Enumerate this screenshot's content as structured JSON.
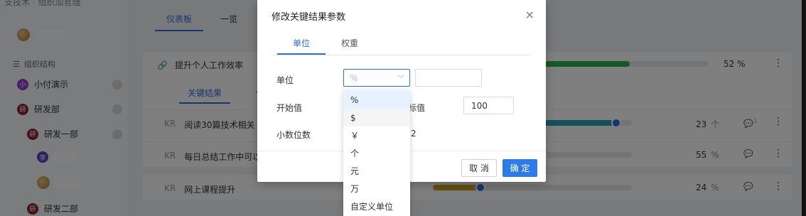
{
  "sidebar": {
    "top_text": "支技术 · 组织加官理",
    "section_title": "组织结构",
    "items": [
      {
        "avatar": "小",
        "label": "小付演示"
      },
      {
        "avatar": "研",
        "label": "研发部"
      },
      {
        "avatar": "研",
        "label": "研发一部"
      },
      {
        "avatar": "李",
        "label": ""
      },
      {
        "avatar": "",
        "label": ""
      },
      {
        "avatar": "研",
        "label": "研发二部"
      }
    ]
  },
  "main": {
    "tabs": [
      "仪表板",
      "一览"
    ],
    "goal": {
      "title": "提升个人工作效率",
      "progress_pct": 52,
      "pct_label": "52 %"
    },
    "subtabs": [
      "关键结果",
      "任务"
    ],
    "krs": [
      {
        "tag": "KR",
        "title": "阅读30篇技术相关",
        "value": "23",
        "unit": "个",
        "progress": 0.92,
        "badge": "1"
      },
      {
        "tag": "KR",
        "title": "每日总结工作中可以",
        "value": "55",
        "unit": "%",
        "progress": 0.55
      },
      {
        "tag": "KR",
        "title": "网上课程提升",
        "value": "24",
        "unit": "%",
        "progress": 0.24
      }
    ]
  },
  "dialog": {
    "title": "修改关键结果参数",
    "close_icon": "×",
    "tabs": [
      "单位",
      "权重"
    ],
    "labels": {
      "unit": "单位",
      "start": "开始值",
      "target_partial": "标值",
      "decimals": "小数位数"
    },
    "unit_value": "%",
    "target_value": "100",
    "decimals_value": "2",
    "cancel_label": "取 消",
    "ok_label": "确 定",
    "unit_options": [
      "%",
      "$",
      "￥",
      "个",
      "元",
      "万",
      "自定义单位"
    ]
  },
  "colors": {
    "accent": "#2d6fd8",
    "green": "#2bb24c",
    "teal": "#25a1b5",
    "gold": "#c9a227"
  }
}
